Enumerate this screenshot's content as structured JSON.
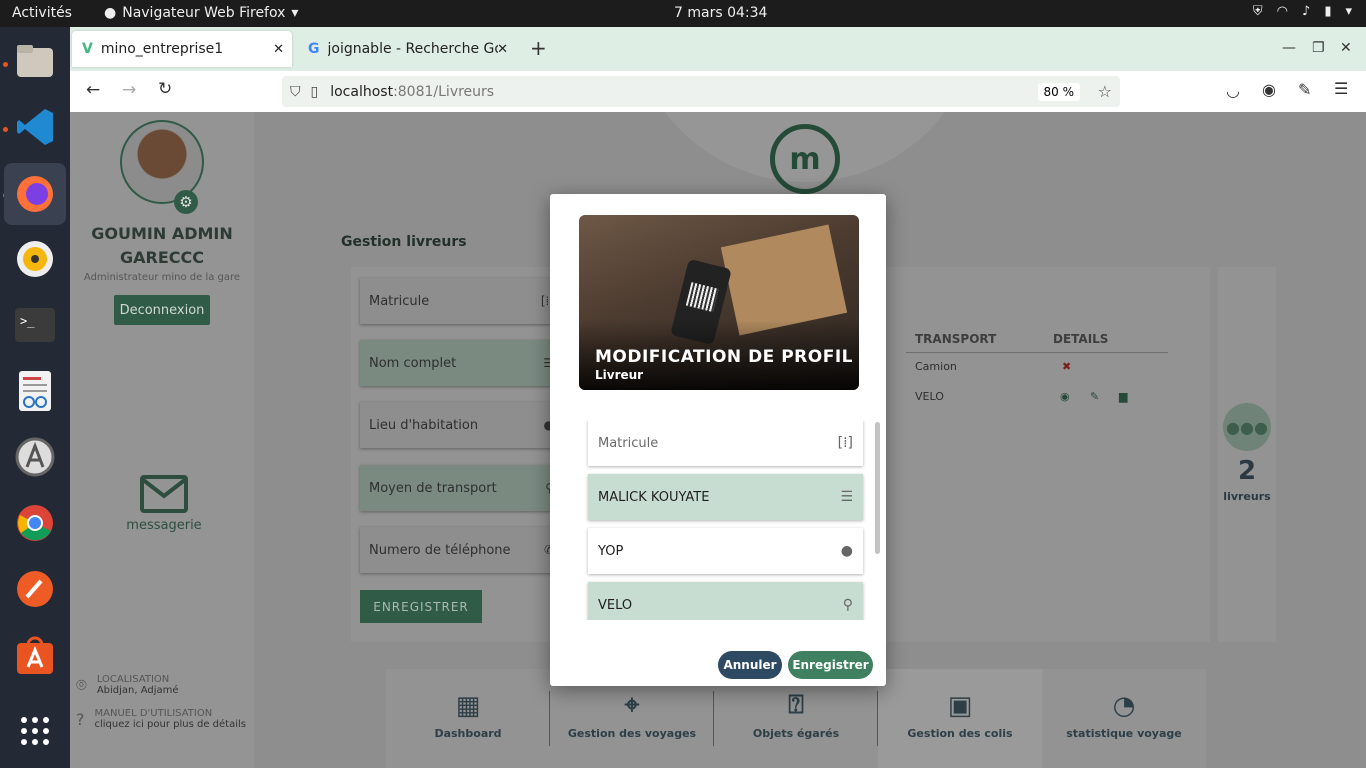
{
  "system": {
    "activities": "Activités",
    "app_menu": "Navigateur Web Firefox",
    "clock": "7 mars  04:34"
  },
  "browser": {
    "tabs": [
      {
        "label": "mino_entreprise1"
      },
      {
        "label": "joignable - Recherche Go"
      }
    ],
    "url_host": "localhost",
    "url_path": ":8081/Livreurs",
    "zoom": "80 %"
  },
  "sidebar": {
    "name": "GOUMIN ADMIN GARECCC",
    "role": "Administrateur mino de la gare",
    "logout": "Deconnexion",
    "messaging": "messagerie",
    "location_label": "LOCALISATION",
    "location_value": "Abidjan, Adjamé",
    "manual_label": "MANUEL D'UTILISATION",
    "manual_value": "cliquez ici pour plus de détails"
  },
  "main": {
    "logo": "m",
    "section_title": "Gestion livreurs",
    "form": {
      "matricule": "Matricule",
      "nom": "Nom complet",
      "lieu": "Lieu d'habitation",
      "moyen": "Moyen de transport",
      "tel": "Numero de téléphone",
      "save": "ENREGISTRER"
    },
    "table": {
      "headers": [
        "TRANSPORT",
        "DETAILS"
      ],
      "rows": [
        {
          "transport": "Camion"
        },
        {
          "transport": "VELO"
        }
      ]
    },
    "stat": {
      "count": "2",
      "label": "livreurs"
    },
    "bottom_nav": [
      {
        "label": "Dashboard"
      },
      {
        "label": "Gestion des voyages"
      },
      {
        "label": "Objets égarés"
      },
      {
        "label": "Gestion des colis"
      },
      {
        "label": "statistique voyage"
      }
    ]
  },
  "modal": {
    "title": "MODIFICATION DE PROFIL",
    "subtitle": "Livreur",
    "fields": {
      "matricule_placeholder": "Matricule",
      "nom": "MALICK KOUYATE",
      "lieu": "YOP",
      "transport": "VELO"
    },
    "cancel": "Annuler",
    "save": "Enregistrer"
  }
}
